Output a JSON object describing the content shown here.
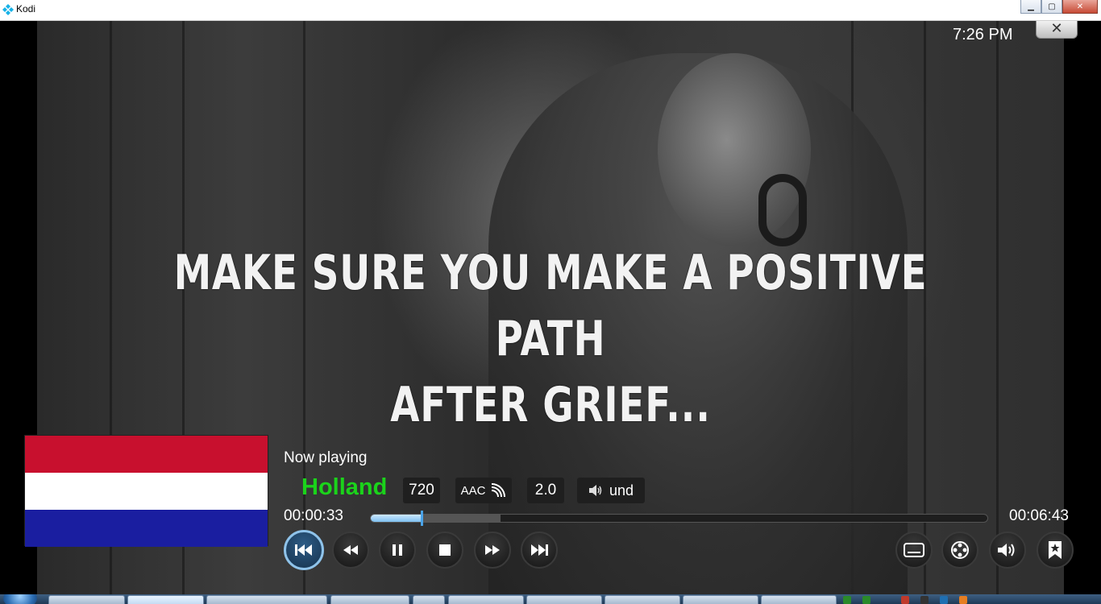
{
  "window": {
    "title": "Kodi",
    "controls": [
      "minimize",
      "maximize",
      "close"
    ]
  },
  "player": {
    "clock": "7:26 PM",
    "subtitle_line1": "MAKE SURE YOU MAKE A POSITIVE PATH",
    "subtitle_line2": "AFTER GRIEF...",
    "now_playing_label": "Now playing",
    "title": "Holland",
    "title_color": "#1bd31b",
    "badges": {
      "resolution": "720",
      "audio_codec": "AAC",
      "channels": "2.0",
      "language": "und"
    },
    "time_current": "00:00:33",
    "time_total": "00:06:43",
    "progress_fraction": 0.082,
    "cache_fraction": 0.21,
    "flag_colors": [
      "#c8102e",
      "#ffffff",
      "#1a1ea0"
    ],
    "buttons_left": [
      "previous-icon",
      "rewind-icon",
      "pause-icon",
      "stop-icon",
      "fast-forward-icon",
      "next-icon"
    ],
    "buttons_right": [
      "subtitles-icon",
      "video-settings-icon",
      "volume-icon",
      "bookmark-icon"
    ]
  }
}
